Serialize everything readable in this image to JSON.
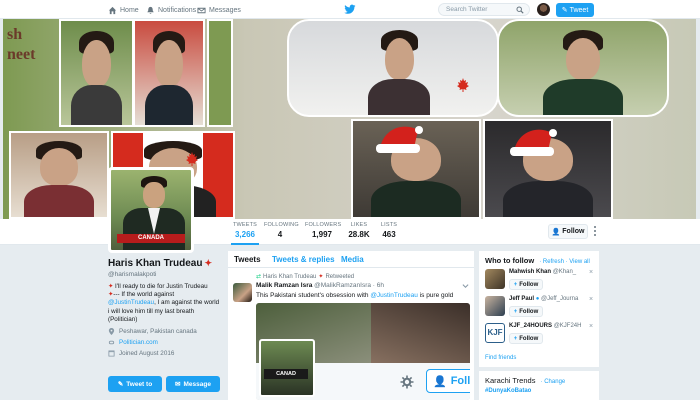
{
  "nav": {
    "home": "Home",
    "notifications": "Notifications",
    "messages": "Messages",
    "search_placeholder": "Search Twitter",
    "tweet_button": "Tweet"
  },
  "banner": {
    "word_line1": "sh",
    "word_line2": "neet"
  },
  "stats": [
    {
      "label": "TWEETS",
      "value": "3,266"
    },
    {
      "label": "FOLLOWING",
      "value": "4"
    },
    {
      "label": "FOLLOWERS",
      "value": "1,997"
    },
    {
      "label": "LIKES",
      "value": "28.8K"
    },
    {
      "label": "LISTS",
      "value": "463"
    }
  ],
  "follow_label": "Follow",
  "avatar_caption": "CANADA",
  "profile": {
    "name": "Haris Khan Trudeau",
    "handle": "@harismalakpoti",
    "bio_line1": "I'll ready to die for Justin Trudeau",
    "bio_line2": "If the world against",
    "bio_link": "@JustinTrudeau",
    "bio_line3": ", I am against the world",
    "bio_line4": "i will love him till my last breath",
    "bio_line5": "(Politician)",
    "location": "Peshawar, Pakistan canada",
    "website": "Politician.com",
    "joined": "Joined August 2016",
    "tweet_to": "Tweet to",
    "message": "Message"
  },
  "timeline": {
    "tabs": [
      "Tweets",
      "Tweets & replies",
      "Media"
    ],
    "retweeted_by": "Haris Khan Trudeau",
    "retweeted_label": "Retweeted",
    "author_name": "Malik Ramzan Isra",
    "author_handle": "@MalikRamzanIsra",
    "time": "6h",
    "text_before": "This Pakistani student's obsession with ",
    "text_link": "@JustinTrudeau",
    "text_after": " is pure gold",
    "media_caption": "CANAD",
    "media_follow": "Follow"
  },
  "who_to_follow": {
    "title": "Who to follow",
    "refresh": "Refresh",
    "view_all": "View all",
    "items": [
      {
        "name": "Mahwish Khan",
        "handle": "@Khan_",
        "follow": "Follow"
      },
      {
        "name": "Jeff Paul",
        "handle": "@Jeff_Journa",
        "follow": "Follow"
      },
      {
        "name": "KJF_24HOURS",
        "handle": "@KJF24H",
        "follow": "Follow"
      }
    ],
    "find_friends": "Find friends"
  },
  "trends": {
    "title": "Karachi Trends",
    "change": "Change",
    "first": "#DunyaKoBatao"
  },
  "colors": {
    "accent": "#1da1f2",
    "background": "#e6ecf0",
    "canada_red": "#d52b1e"
  }
}
